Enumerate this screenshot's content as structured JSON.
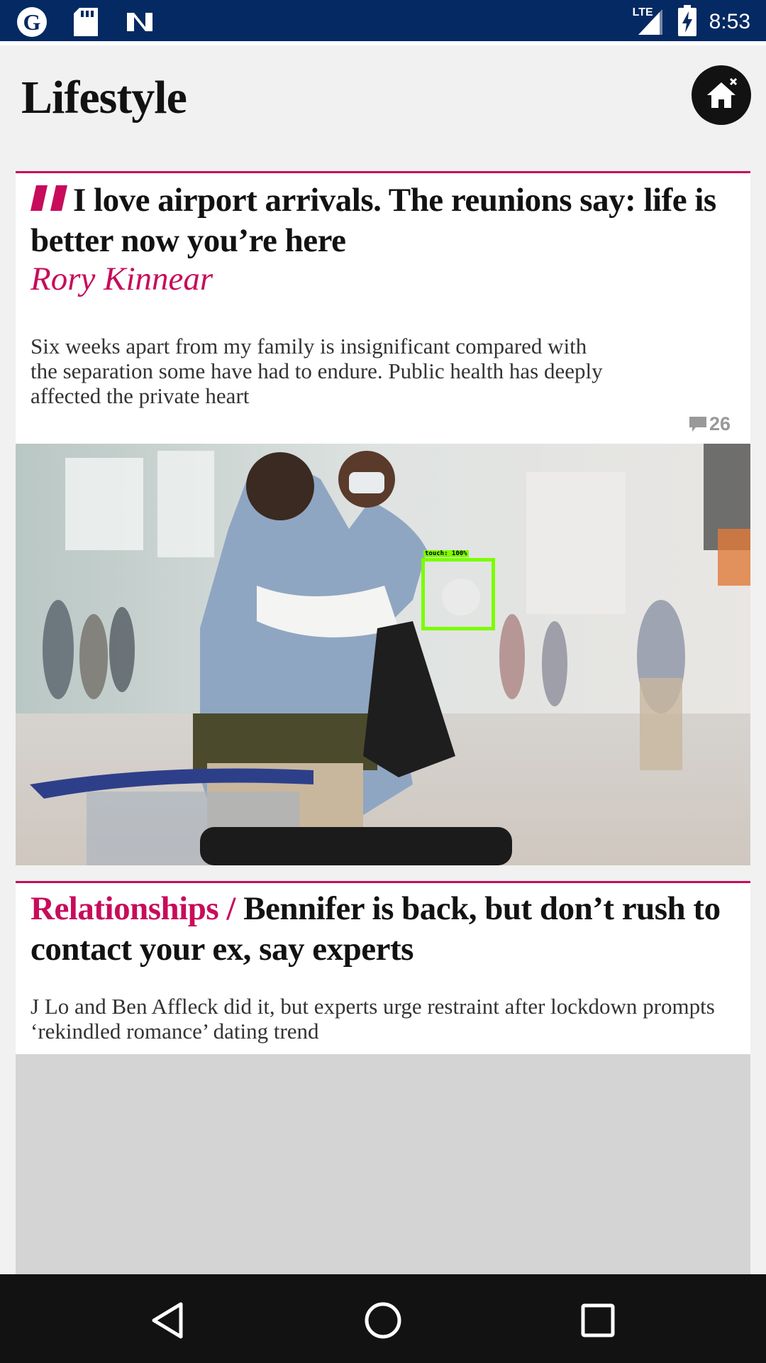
{
  "status_bar": {
    "time": "8:53",
    "network": "LTE",
    "icons": [
      "guardian-app-icon",
      "sd-card-icon",
      "n-app-icon",
      "signal-icon",
      "battery-charging-icon"
    ]
  },
  "header": {
    "title": "Lifestyle",
    "home_button_icon": "home-icon"
  },
  "articles": [
    {
      "headline": "I love airport arrivals. The reunions say: life is better now you’re here",
      "byline": "Rory Kinnear",
      "standfirst": "Six weeks apart from my family is insignificant compared with the separation some have had to endure. Public health has deeply affected the private heart",
      "comment_count": "26",
      "accent_color": "#c70c5b"
    },
    {
      "kicker": "Relationships / ",
      "headline": "Bennifer is back, but don’t rush to contact your ex, say experts",
      "standfirst": "J Lo and Ben Affleck did it, but experts urge restraint after lockdown prompts ‘rekindled romance’ dating trend",
      "accent_color": "#c70c5b"
    }
  ],
  "touch_indicator": {
    "label": "touch: 100%"
  },
  "nav_bar": {
    "icons": [
      "back-icon",
      "home-circle-icon",
      "recents-icon"
    ]
  },
  "colors": {
    "status_bar": "#052962",
    "accent": "#c70c5b",
    "nav_bar": "#121212"
  }
}
